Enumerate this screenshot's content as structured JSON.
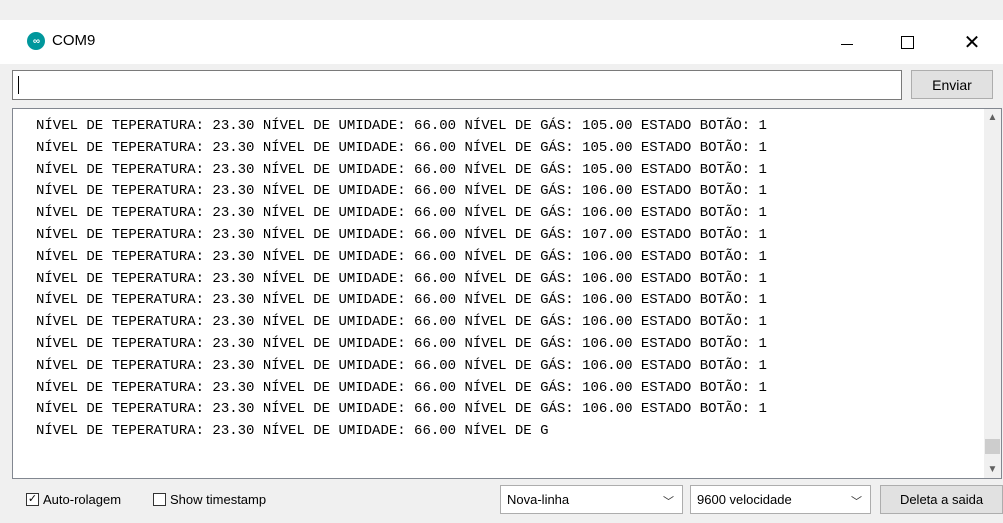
{
  "window": {
    "title": "COM9",
    "icon": "arduino-logo-icon"
  },
  "send": {
    "input_value": "",
    "button_label": "Enviar"
  },
  "output": {
    "lines": [
      "NÍVEL DE TEPERATURA: 23.30 NÍVEL DE UMIDADE: 66.00 NÍVEL DE GÁS: 105.00 ESTADO BOTÃO: 1",
      "NÍVEL DE TEPERATURA: 23.30 NÍVEL DE UMIDADE: 66.00 NÍVEL DE GÁS: 105.00 ESTADO BOTÃO: 1",
      "NÍVEL DE TEPERATURA: 23.30 NÍVEL DE UMIDADE: 66.00 NÍVEL DE GÁS: 105.00 ESTADO BOTÃO: 1",
      "NÍVEL DE TEPERATURA: 23.30 NÍVEL DE UMIDADE: 66.00 NÍVEL DE GÁS: 106.00 ESTADO BOTÃO: 1",
      "NÍVEL DE TEPERATURA: 23.30 NÍVEL DE UMIDADE: 66.00 NÍVEL DE GÁS: 106.00 ESTADO BOTÃO: 1",
      "NÍVEL DE TEPERATURA: 23.30 NÍVEL DE UMIDADE: 66.00 NÍVEL DE GÁS: 107.00 ESTADO BOTÃO: 1",
      "NÍVEL DE TEPERATURA: 23.30 NÍVEL DE UMIDADE: 66.00 NÍVEL DE GÁS: 106.00 ESTADO BOTÃO: 1",
      "NÍVEL DE TEPERATURA: 23.30 NÍVEL DE UMIDADE: 66.00 NÍVEL DE GÁS: 106.00 ESTADO BOTÃO: 1",
      "NÍVEL DE TEPERATURA: 23.30 NÍVEL DE UMIDADE: 66.00 NÍVEL DE GÁS: 106.00 ESTADO BOTÃO: 1",
      "NÍVEL DE TEPERATURA: 23.30 NÍVEL DE UMIDADE: 66.00 NÍVEL DE GÁS: 106.00 ESTADO BOTÃO: 1",
      "NÍVEL DE TEPERATURA: 23.30 NÍVEL DE UMIDADE: 66.00 NÍVEL DE GÁS: 106.00 ESTADO BOTÃO: 1",
      "NÍVEL DE TEPERATURA: 23.30 NÍVEL DE UMIDADE: 66.00 NÍVEL DE GÁS: 106.00 ESTADO BOTÃO: 1",
      "NÍVEL DE TEPERATURA: 23.30 NÍVEL DE UMIDADE: 66.00 NÍVEL DE GÁS: 106.00 ESTADO BOTÃO: 1",
      "NÍVEL DE TEPERATURA: 23.30 NÍVEL DE UMIDADE: 66.00 NÍVEL DE GÁS: 106.00 ESTADO BOTÃO: 1",
      "NÍVEL DE TEPERATURA: 23.30 NÍVEL DE UMIDADE: 66.00 NÍVEL DE G"
    ]
  },
  "footer": {
    "autoscroll_label": "Auto-rolagem",
    "autoscroll_checked": true,
    "timestamp_label": "Show timestamp",
    "timestamp_checked": false,
    "line_ending_value": "Nova-linha",
    "baud_value": "9600 velocidade",
    "clear_label": "Deleta a saida"
  },
  "colors": {
    "accent": "#00979c"
  }
}
